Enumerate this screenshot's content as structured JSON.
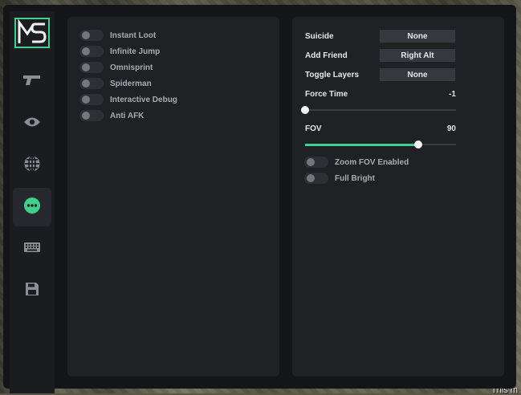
{
  "left_panel": {
    "toggles": [
      {
        "label": "Instant Loot"
      },
      {
        "label": "Infinite Jump"
      },
      {
        "label": "Omnisprint"
      },
      {
        "label": "Spiderman"
      },
      {
        "label": "Interactive Debug"
      },
      {
        "label": "Anti AFK"
      }
    ]
  },
  "right_panel": {
    "keybinds": [
      {
        "label": "Suicide",
        "value": "None"
      },
      {
        "label": "Add Friend",
        "value": "Right Alt"
      },
      {
        "label": "Toggle Layers",
        "value": "None"
      }
    ],
    "force_time": {
      "label": "Force Time",
      "value": "-1",
      "fraction": 0.0
    },
    "fov": {
      "label": "FOV",
      "value": "90",
      "fraction": 0.75
    },
    "toggles": [
      {
        "label": "Zoom FOV Enabled"
      },
      {
        "label": "Full Bright"
      }
    ]
  },
  "sidebar": {
    "active": "misc",
    "icons": [
      "weapon-icon",
      "eye-icon",
      "globe-icon",
      "more-icon",
      "keyboard-icon",
      "save-icon"
    ]
  },
  "corner_text": "This m",
  "colors": {
    "accent": "#3fd08c",
    "panel": "#1f2125",
    "sidebar": "#1b1c20"
  }
}
